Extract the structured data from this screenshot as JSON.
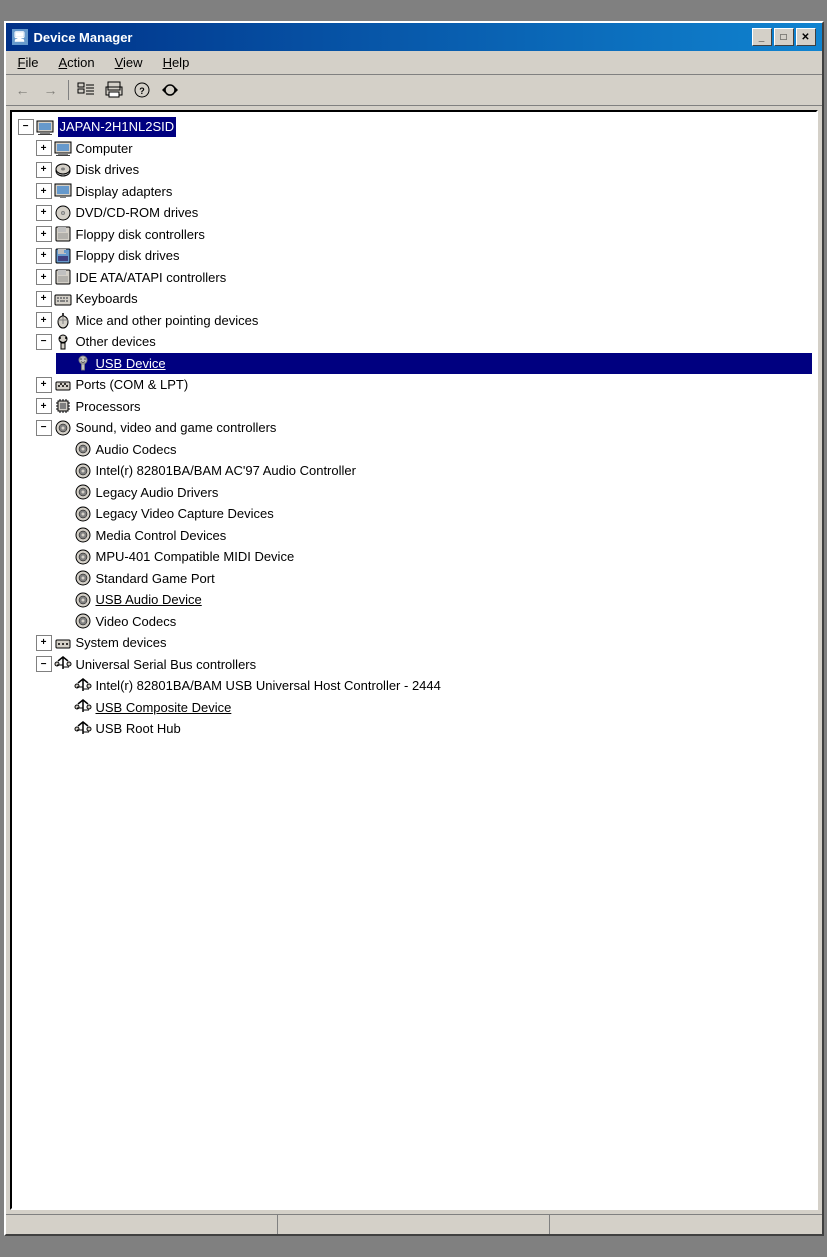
{
  "window": {
    "title": "Device Manager",
    "title_icon": "🖥"
  },
  "title_buttons": {
    "minimize": "_",
    "maximize": "□",
    "close": "✕"
  },
  "menu": {
    "items": [
      {
        "label": "File",
        "underline_index": 0
      },
      {
        "label": "Action",
        "underline_index": 0
      },
      {
        "label": "View",
        "underline_index": 0
      },
      {
        "label": "Help",
        "underline_index": 0
      }
    ]
  },
  "toolbar": {
    "buttons": [
      "←",
      "→",
      "⊟",
      "🖨",
      "🔍",
      "📋"
    ]
  },
  "tree": {
    "root": "JAPAN-2H1NL2SID",
    "items": [
      {
        "id": "root",
        "label": "JAPAN-2H1NL2SID",
        "icon": "💻",
        "level": 0,
        "expanded": true,
        "has_expand": true,
        "selected": false
      },
      {
        "id": "computer",
        "label": "Computer",
        "icon": "🖥",
        "level": 1,
        "expanded": false,
        "has_expand": true,
        "selected": false
      },
      {
        "id": "disk",
        "label": "Disk drives",
        "icon": "💾",
        "level": 1,
        "expanded": false,
        "has_expand": true,
        "selected": false
      },
      {
        "id": "display",
        "label": "Display adapters",
        "icon": "🖥",
        "level": 1,
        "expanded": false,
        "has_expand": true,
        "selected": false
      },
      {
        "id": "dvd",
        "label": "DVD/CD-ROM drives",
        "icon": "💿",
        "level": 1,
        "expanded": false,
        "has_expand": true,
        "selected": false
      },
      {
        "id": "floppy_ctrl",
        "label": "Floppy disk controllers",
        "icon": "🖨",
        "level": 1,
        "expanded": false,
        "has_expand": true,
        "selected": false
      },
      {
        "id": "floppy_drv",
        "label": "Floppy disk drives",
        "icon": "💾",
        "level": 1,
        "expanded": false,
        "has_expand": true,
        "selected": false
      },
      {
        "id": "ide",
        "label": "IDE ATA/ATAPI controllers",
        "icon": "🖨",
        "level": 1,
        "expanded": false,
        "has_expand": true,
        "selected": false
      },
      {
        "id": "keyboards",
        "label": "Keyboards",
        "icon": "⌨",
        "level": 1,
        "expanded": false,
        "has_expand": true,
        "selected": false
      },
      {
        "id": "mice",
        "label": "Mice and other pointing devices",
        "icon": "🖱",
        "level": 1,
        "expanded": false,
        "has_expand": true,
        "selected": false
      },
      {
        "id": "other",
        "label": "Other devices",
        "icon": "🔊",
        "level": 1,
        "expanded": true,
        "has_expand": true,
        "selected": false
      },
      {
        "id": "usb_device",
        "label": "USB Device",
        "icon": "🔊",
        "level": 2,
        "expanded": false,
        "has_expand": false,
        "selected": true,
        "underlined": true
      },
      {
        "id": "ports",
        "label": "Ports (COM & LPT)",
        "icon": "🔌",
        "level": 1,
        "expanded": false,
        "has_expand": true,
        "selected": false
      },
      {
        "id": "processors",
        "label": "Processors",
        "icon": "⚡",
        "level": 1,
        "expanded": false,
        "has_expand": true,
        "selected": false
      },
      {
        "id": "sound",
        "label": "Sound, video and game controllers",
        "icon": "🎵",
        "level": 1,
        "expanded": true,
        "has_expand": true,
        "selected": false
      },
      {
        "id": "audio_codecs",
        "label": "Audio Codecs",
        "icon": "🎵",
        "level": 2,
        "expanded": false,
        "has_expand": false,
        "selected": false
      },
      {
        "id": "intel_audio",
        "label": "Intel(r) 82801BA/BAM AC'97 Audio Controller",
        "icon": "🎵",
        "level": 2,
        "expanded": false,
        "has_expand": false,
        "selected": false
      },
      {
        "id": "legacy_audio",
        "label": "Legacy Audio Drivers",
        "icon": "🎵",
        "level": 2,
        "expanded": false,
        "has_expand": false,
        "selected": false
      },
      {
        "id": "legacy_video",
        "label": "Legacy Video Capture Devices",
        "icon": "🎵",
        "level": 2,
        "expanded": false,
        "has_expand": false,
        "selected": false
      },
      {
        "id": "media_ctrl",
        "label": "Media Control Devices",
        "icon": "🎵",
        "level": 2,
        "expanded": false,
        "has_expand": false,
        "selected": false
      },
      {
        "id": "mpu",
        "label": "MPU-401 Compatible MIDI Device",
        "icon": "🎵",
        "level": 2,
        "expanded": false,
        "has_expand": false,
        "selected": false
      },
      {
        "id": "game_port",
        "label": "Standard Game Port",
        "icon": "🎵",
        "level": 2,
        "expanded": false,
        "has_expand": false,
        "selected": false
      },
      {
        "id": "usb_audio",
        "label": "USB Audio Device",
        "icon": "🎵",
        "level": 2,
        "expanded": false,
        "has_expand": false,
        "selected": false,
        "underlined": true
      },
      {
        "id": "video_codecs",
        "label": "Video Codecs",
        "icon": "🎵",
        "level": 2,
        "expanded": false,
        "has_expand": false,
        "selected": false
      },
      {
        "id": "system",
        "label": "System devices",
        "icon": "🔌",
        "level": 1,
        "expanded": false,
        "has_expand": true,
        "selected": false
      },
      {
        "id": "usb_ctrl",
        "label": "Universal Serial Bus controllers",
        "icon": "↔",
        "level": 1,
        "expanded": true,
        "has_expand": true,
        "selected": false
      },
      {
        "id": "intel_usb",
        "label": "Intel(r) 82801BA/BAM USB Universal Host Controller - 2444",
        "icon": "↔",
        "level": 2,
        "expanded": false,
        "has_expand": false,
        "selected": false
      },
      {
        "id": "usb_composite",
        "label": "USB Composite Device",
        "icon": "↔",
        "level": 2,
        "expanded": false,
        "has_expand": false,
        "selected": false,
        "underlined": true
      },
      {
        "id": "usb_root",
        "label": "USB Root Hub",
        "icon": "↔",
        "level": 2,
        "expanded": false,
        "has_expand": false,
        "selected": false
      }
    ]
  },
  "status_panes": [
    "",
    "",
    ""
  ]
}
